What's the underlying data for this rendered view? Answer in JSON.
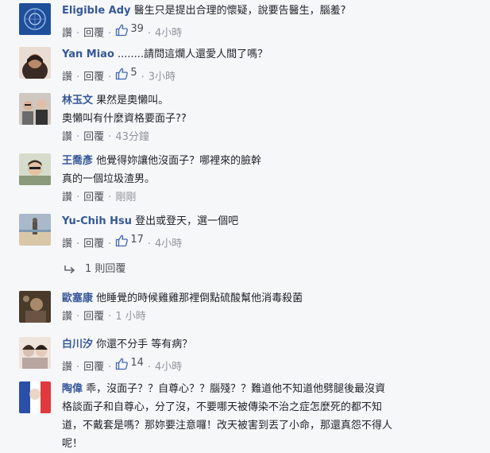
{
  "comments": [
    {
      "id": "c1",
      "name": "Eligible Ady",
      "lines": [
        "醫生只是提出合理的懷疑，說要告醫生，腦羞?"
      ],
      "like_label": "讚",
      "reply_label": "回覆",
      "likes": "39",
      "time": "4小時",
      "avatar": "blue-abstract-avatar",
      "avatar_color": "#1f4f9a"
    },
    {
      "id": "c2",
      "name": "Yan Miao",
      "lines": [
        "........請問這爛人還愛人間了嗎？"
      ],
      "like_label": "讚",
      "reply_label": "回覆",
      "likes": "5",
      "time": "3小時",
      "avatar": "woman-portrait-avatar",
      "avatar_color": "#b88a6a"
    },
    {
      "id": "c3",
      "name": "林玉文",
      "lines": [
        "果然是奧懶叫。",
        "奧懶叫有什麼資格要面子??"
      ],
      "like_label": "讚",
      "reply_label": "回覆",
      "likes": "",
      "time": "43分鐘",
      "avatar": "group-photo-avatar",
      "avatar_color": "#6b6b6b"
    },
    {
      "id": "c4",
      "name": "王喬彥",
      "lines": [
        "他覺得妳讓他沒面子？哪裡來的臉幹",
        "真的一個垃圾渣男。"
      ],
      "like_label": "讚",
      "reply_label": "回覆",
      "likes": "",
      "time": "剛剛",
      "avatar": "man-portrait-avatar",
      "avatar_color": "#8a9a7a"
    },
    {
      "id": "c5",
      "name": "Yu-Chih Hsu",
      "lines": [
        "登出或登天，選一個吧"
      ],
      "like_label": "讚",
      "reply_label": "回覆",
      "likes": "17",
      "time": "4小時",
      "avatar": "beach-scene-avatar",
      "avatar_color": "#a9b9c9",
      "reply_count_label": "1 則回覆"
    },
    {
      "id": "c6",
      "name": "歐塞康",
      "lines": [
        "他睡覺的時候雞雞那裡倒點硫酸幫他消毒殺菌"
      ],
      "like_label": "讚",
      "reply_label": "回覆",
      "likes": "",
      "time": "1 小時",
      "avatar": "dark-scene-avatar",
      "avatar_color": "#4a3a2a"
    },
    {
      "id": "c7",
      "name": "白川汐",
      "lines": [
        "你還不分手 等有病？"
      ],
      "like_label": "讚",
      "reply_label": "回覆",
      "likes": "14",
      "time": "4小時",
      "avatar": "two-girls-avatar",
      "avatar_color": "#d8c0b0"
    },
    {
      "id": "c8",
      "name": "陶偉",
      "lines": [
        "乖，沒面子？？自尊心？？腦殘？？難道他不知道他劈腿後最沒資",
        "格談面子和自尊心，分了沒，不要哪天被傳染不治之症怎麼死的都不知",
        "道，不戴套是嗎？那妳要注意囉！改天被害到丟了小命，那還真怨不得人",
        "呢！"
      ],
      "avatar": "french-flag-avatar",
      "avatar_color": "#2a4fa8"
    }
  ],
  "colors": {
    "name": "#365899",
    "action_link": "#4b4f56",
    "meta": "#90949c",
    "background": "#f6f7f9"
  },
  "icons": {
    "like": "thumbs-up-icon",
    "reply": "reply-arrow-icon"
  }
}
